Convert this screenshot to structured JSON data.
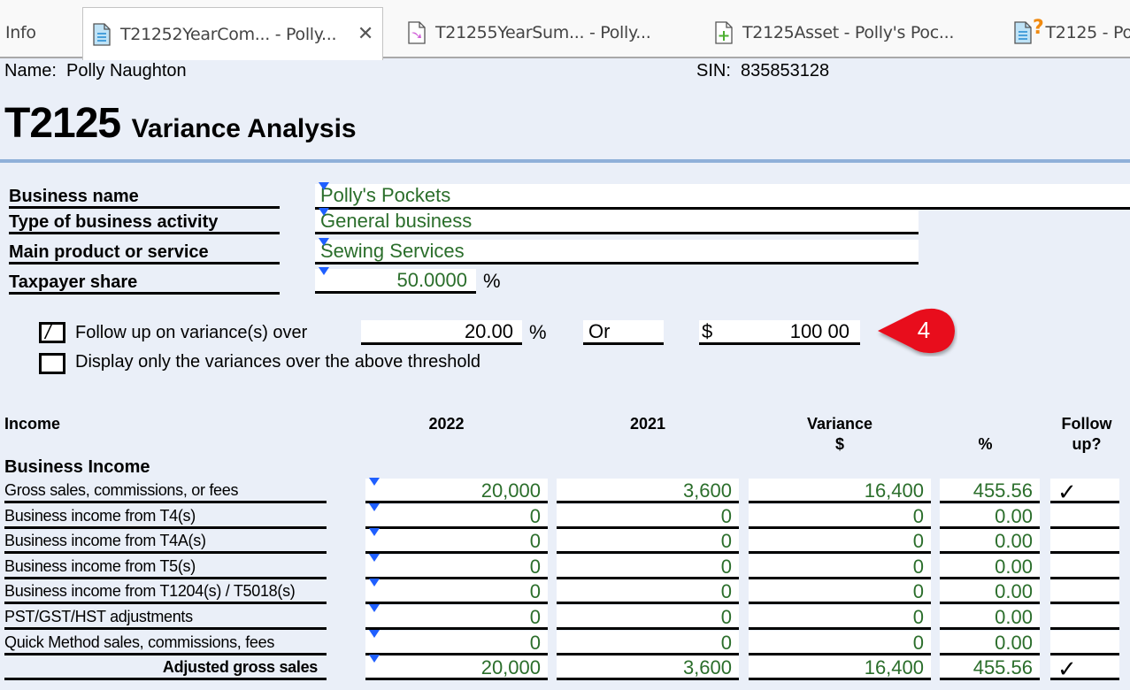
{
  "tabs": [
    {
      "label": "Info",
      "icon": "none",
      "active": false
    },
    {
      "label": "T21252YearCom... - Polly...",
      "icon": "document-icon",
      "active": true,
      "closable": true
    },
    {
      "label": "T21255YearSum... - Polly...",
      "icon": "document-arrow-icon",
      "active": false
    },
    {
      "label": "T2125Asset - Polly's Poc...",
      "icon": "document-plus-icon",
      "active": false
    },
    {
      "label": "T2125 - Po",
      "icon": "document-question-icon",
      "active": false
    }
  ],
  "header": {
    "name_label": "Name:",
    "name_value": "Polly Naughton",
    "sin_label": "SIN:",
    "sin_value": "835853128",
    "form_number": "T2125",
    "form_title": "Variance Analysis"
  },
  "business": {
    "business_name_label": "Business name",
    "business_name_value": "Polly's Pockets",
    "activity_label": "Type of business activity",
    "activity_value": "General business",
    "product_label": "Main product or service",
    "product_value": "Sewing Services",
    "share_label": "Taxpayer share",
    "share_value": "50.0000",
    "share_unit": "%"
  },
  "options": {
    "followup_label": "Follow up on variance(s) over",
    "followup_checked": true,
    "followup_percent": "20.00",
    "percent_unit": "%",
    "or_label": "Or",
    "dollar_sign": "$",
    "followup_amount": "100 00",
    "display_only_label": "Display only the variances over the above threshold",
    "display_only_checked": false,
    "callout_number": "4",
    "callout_color": "#e8101a"
  },
  "table": {
    "header_income": "Income",
    "header_2022": "2022",
    "header_2021": "2021",
    "header_variance": "Variance",
    "header_variance_dollar": "$",
    "header_percent": "%",
    "header_follow1": "Follow",
    "header_follow2": "up?",
    "section_title": "Business Income",
    "check_mark": "✓",
    "rows": [
      {
        "label": "Gross sales, commissions, or fees",
        "y2022": "20,000",
        "y2021": "3,600",
        "var": "16,400",
        "pct": "455.56",
        "follow": true
      },
      {
        "label": "Business income from T4(s)",
        "y2022": "0",
        "y2021": "0",
        "var": "0",
        "pct": "0.00",
        "follow": false
      },
      {
        "label": "Business income from T4A(s)",
        "y2022": "0",
        "y2021": "0",
        "var": "0",
        "pct": "0.00",
        "follow": false
      },
      {
        "label": "Business income from T5(s)",
        "y2022": "0",
        "y2021": "0",
        "var": "0",
        "pct": "0.00",
        "follow": false
      },
      {
        "label": "Business income from T1204(s) / T5018(s)",
        "y2022": "0",
        "y2021": "0",
        "var": "0",
        "pct": "0.00",
        "follow": false
      },
      {
        "label": "PST/GST/HST adjustments",
        "y2022": "0",
        "y2021": "0",
        "var": "0",
        "pct": "0.00",
        "follow": false
      },
      {
        "label": "Quick Method sales, commissions, fees",
        "y2022": "0",
        "y2021": "0",
        "var": "0",
        "pct": "0.00",
        "follow": false
      },
      {
        "label": "Adjusted gross sales",
        "y2022": "20,000",
        "y2021": "3,600",
        "var": "16,400",
        "pct": "455.56",
        "follow": true,
        "total": true
      }
    ]
  }
}
